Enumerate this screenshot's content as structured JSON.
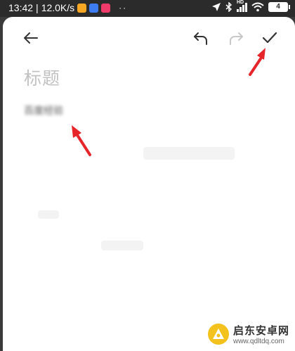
{
  "status_bar": {
    "time": "13:42",
    "net_speed": "12.0K/s",
    "dots": "··",
    "network_label": "HD",
    "battery": "4"
  },
  "toolbar": {
    "back_icon": "arrow-left-icon",
    "undo_icon": "undo-icon",
    "redo_icon": "redo-icon",
    "done_icon": "check-icon"
  },
  "editor": {
    "title_placeholder": "标题",
    "body_text": "百度经验"
  },
  "watermark": {
    "title": "启东安卓网",
    "url": "www.qdltdq.com"
  },
  "colors": {
    "accent_arrow": "#e5252a",
    "icon": "#333333",
    "icon_disabled": "#c8c8c8",
    "placeholder": "#c2c2c2"
  }
}
